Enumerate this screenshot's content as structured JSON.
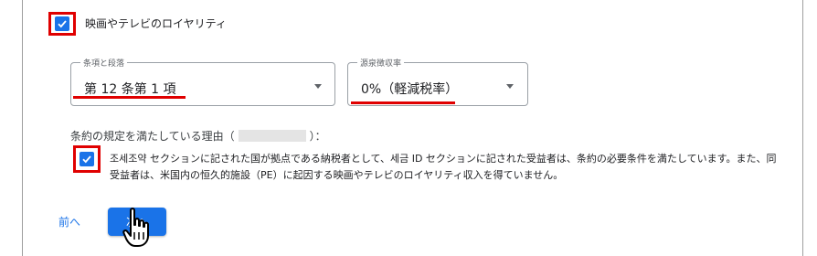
{
  "royalty_checkbox": {
    "label": "映画やテレビのロイヤリティ",
    "checked": true
  },
  "article_select": {
    "legend": "条項と段落",
    "value": "第 12 条第 1 項"
  },
  "withholding_select": {
    "legend": "源泉徴収率",
    "value": "0%（軽減税率）"
  },
  "reason": {
    "label_prefix": "条約の規定を満たしている理由（",
    "label_suffix": "）：",
    "checked": true,
    "text": "조세조약 セクションに記された国が拠点である納税者として、세금 ID セクションに記された受益者は、条約の必要条件を満たしています。また、同受益者は、米国内の恒久的施設（PE）に起因する映画やテレビのロイヤリティ収入を得ていません。"
  },
  "nav": {
    "prev_label": "前へ",
    "next_label": "次へ"
  },
  "colors": {
    "accent": "#1a73e8",
    "highlight": "#e00000"
  }
}
